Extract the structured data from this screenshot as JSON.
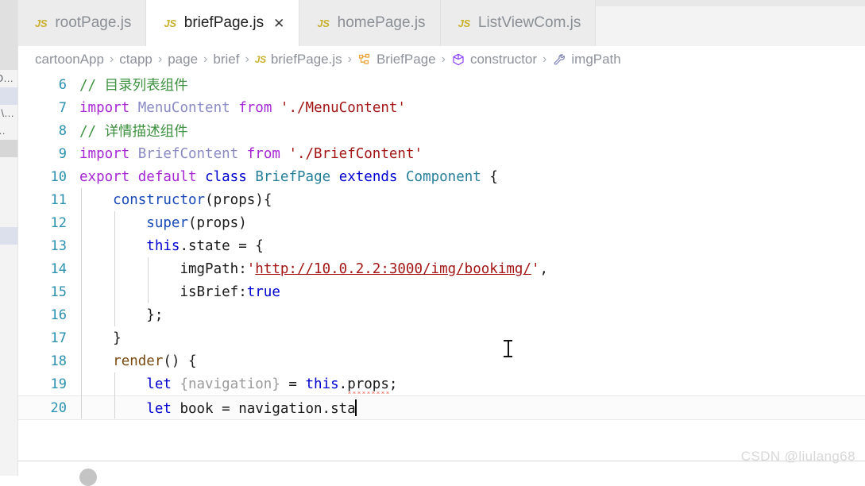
{
  "tabs": [
    {
      "label": "rootPage.js",
      "icon": "js-file-icon",
      "badge": "JS",
      "active": false,
      "closable": false
    },
    {
      "label": "briefPage.js",
      "icon": "js-file-icon",
      "badge": "JS",
      "active": true,
      "closable": true,
      "close_glyph": "✕"
    },
    {
      "label": "homePage.js",
      "icon": "js-file-icon",
      "badge": "JS",
      "active": false,
      "closable": false
    },
    {
      "label": "ListViewCom.js",
      "icon": "js-file-icon",
      "badge": "JS",
      "active": false,
      "closable": false
    }
  ],
  "breadcrumb": {
    "separator": "›",
    "items": [
      {
        "label": "cartoonApp",
        "icon": null
      },
      {
        "label": "ctapp",
        "icon": null
      },
      {
        "label": "page",
        "icon": null
      },
      {
        "label": "brief",
        "icon": null
      },
      {
        "label": "briefPage.js",
        "icon": "js-file-icon",
        "badge": "JS"
      },
      {
        "label": "BriefPage",
        "icon": "class-icon"
      },
      {
        "label": "constructor",
        "icon": "method-cube-icon"
      },
      {
        "label": "imgPath",
        "icon": "property-wrench-icon"
      }
    ]
  },
  "sidebar_sliver": {
    "rows": [
      {
        "text": "O…",
        "state": "normal"
      },
      {
        "text": "",
        "state": "selected"
      },
      {
        "text": "׀\\…",
        "state": "normal"
      },
      {
        "text": "…",
        "state": "normal"
      },
      {
        "text": "",
        "state": "grey"
      },
      {
        "text": "",
        "state": "normal"
      },
      {
        "text": "",
        "state": "normal"
      },
      {
        "text": "",
        "state": "normal"
      },
      {
        "text": "",
        "state": "normal"
      },
      {
        "text": "",
        "state": "selected"
      }
    ]
  },
  "editor": {
    "language": "javascript",
    "cursor_line": 20,
    "first_visible_line": 6,
    "last_visible_line": 20,
    "lines": [
      {
        "num": "6",
        "indent": 0,
        "tokens": [
          {
            "t": "// 目录列表组件",
            "c": "t-comment"
          }
        ]
      },
      {
        "num": "7",
        "indent": 0,
        "tokens": [
          {
            "t": "import",
            "c": "t-kw"
          },
          {
            "t": " ",
            "c": "t-plain"
          },
          {
            "t": "MenuContent",
            "c": "t-ident"
          },
          {
            "t": " ",
            "c": "t-plain"
          },
          {
            "t": "from",
            "c": "t-kw"
          },
          {
            "t": " ",
            "c": "t-plain"
          },
          {
            "t": "'./MenuContent'",
            "c": "t-str"
          }
        ]
      },
      {
        "num": "8",
        "indent": 0,
        "tokens": [
          {
            "t": "// 详情描述组件",
            "c": "t-comment"
          }
        ]
      },
      {
        "num": "9",
        "indent": 0,
        "tokens": [
          {
            "t": "import",
            "c": "t-kw"
          },
          {
            "t": " ",
            "c": "t-plain"
          },
          {
            "t": "BriefContent",
            "c": "t-ident"
          },
          {
            "t": " ",
            "c": "t-plain"
          },
          {
            "t": "from",
            "c": "t-kw"
          },
          {
            "t": " ",
            "c": "t-plain"
          },
          {
            "t": "'./BriefContent'",
            "c": "t-str"
          }
        ]
      },
      {
        "num": "10",
        "indent": 0,
        "tokens": [
          {
            "t": "export",
            "c": "t-kw"
          },
          {
            "t": " ",
            "c": "t-plain"
          },
          {
            "t": "default",
            "c": "t-kw"
          },
          {
            "t": " ",
            "c": "t-plain"
          },
          {
            "t": "class",
            "c": "t-kw2"
          },
          {
            "t": " ",
            "c": "t-plain"
          },
          {
            "t": "BriefPage",
            "c": "t-type"
          },
          {
            "t": " ",
            "c": "t-plain"
          },
          {
            "t": "extends",
            "c": "t-kw2"
          },
          {
            "t": " ",
            "c": "t-plain"
          },
          {
            "t": "Component",
            "c": "t-type"
          },
          {
            "t": " {",
            "c": "t-plain"
          }
        ]
      },
      {
        "num": "11",
        "indent": 1,
        "tokens": [
          {
            "t": "    ",
            "c": "t-plain"
          },
          {
            "t": "constructor",
            "c": "t-fnblue"
          },
          {
            "t": "(props){",
            "c": "t-plain"
          }
        ]
      },
      {
        "num": "12",
        "indent": 2,
        "tokens": [
          {
            "t": "        ",
            "c": "t-plain"
          },
          {
            "t": "super",
            "c": "t-fnblue"
          },
          {
            "t": "(props)",
            "c": "t-plain"
          }
        ]
      },
      {
        "num": "13",
        "indent": 2,
        "tokens": [
          {
            "t": "        ",
            "c": "t-plain"
          },
          {
            "t": "this",
            "c": "t-kw2"
          },
          {
            "t": ".state = {",
            "c": "t-plain"
          }
        ]
      },
      {
        "num": "14",
        "indent": 3,
        "tokens": [
          {
            "t": "            ",
            "c": "t-plain"
          },
          {
            "t": "imgPath:",
            "c": "t-plain"
          },
          {
            "t": "'",
            "c": "t-str"
          },
          {
            "t": "http://10.0.2.2:3000/img/bookimg/",
            "c": "t-link"
          },
          {
            "t": "'",
            "c": "t-str"
          },
          {
            "t": ",",
            "c": "t-plain"
          }
        ]
      },
      {
        "num": "15",
        "indent": 3,
        "tokens": [
          {
            "t": "            ",
            "c": "t-plain"
          },
          {
            "t": "isBrief:",
            "c": "t-plain"
          },
          {
            "t": "true",
            "c": "t-kw2"
          }
        ]
      },
      {
        "num": "16",
        "indent": 2,
        "tokens": [
          {
            "t": "        ",
            "c": "t-plain"
          },
          {
            "t": "};",
            "c": "t-plain"
          }
        ]
      },
      {
        "num": "17",
        "indent": 1,
        "tokens": [
          {
            "t": "    ",
            "c": "t-plain"
          },
          {
            "t": "}",
            "c": "t-plain"
          }
        ]
      },
      {
        "num": "18",
        "indent": 1,
        "tokens": [
          {
            "t": "    ",
            "c": "t-plain"
          },
          {
            "t": "render",
            "c": "t-fn"
          },
          {
            "t": "() {",
            "c": "t-plain"
          }
        ]
      },
      {
        "num": "19",
        "indent": 2,
        "tokens": [
          {
            "t": "        ",
            "c": "t-plain"
          },
          {
            "t": "let",
            "c": "t-kw2"
          },
          {
            "t": " ",
            "c": "t-plain"
          },
          {
            "t": "{navigation}",
            "c": "t-dim"
          },
          {
            "t": " = ",
            "c": "t-plain"
          },
          {
            "t": "this",
            "c": "t-kw2"
          },
          {
            "t": ".",
            "c": "t-plain"
          },
          {
            "t": "props",
            "c": "t-plain squiggle"
          },
          {
            "t": ";",
            "c": "t-plain"
          }
        ]
      },
      {
        "num": "20",
        "indent": 2,
        "current": true,
        "caret_after": true,
        "tokens": [
          {
            "t": "        ",
            "c": "t-plain"
          },
          {
            "t": "let",
            "c": "t-kw2"
          },
          {
            "t": " book = navigation.sta",
            "c": "t-plain"
          }
        ]
      }
    ]
  },
  "watermark": {
    "text": "CSDN @liulang68"
  }
}
